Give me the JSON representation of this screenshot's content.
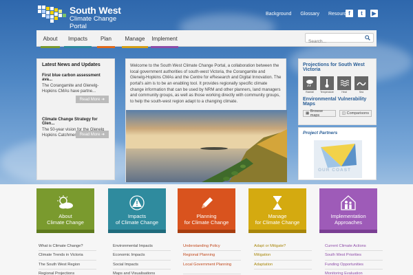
{
  "brand": {
    "line1": "South West",
    "line2": "Climate Change",
    "line3": "Portal"
  },
  "top_links": [
    "Background",
    "Glossary",
    "Resources"
  ],
  "nav": {
    "items": [
      {
        "label": "About",
        "color": "#7a9a2e"
      },
      {
        "label": "Impacts",
        "color": "#2f8b9e"
      },
      {
        "label": "Plan",
        "color": "#e06a1b"
      },
      {
        "label": "Manage",
        "color": "#d4a017"
      },
      {
        "label": "Implement",
        "color": "#8e4ca8"
      }
    ],
    "search_placeholder": "Search..."
  },
  "news": {
    "title": "Latest News and Updates",
    "items": [
      {
        "title": "First blue carbon assessment ava...",
        "summary": "The Corangamite and Glenelg-Hopkins CMAs have partne..."
      },
      {
        "title": "Climate Change Strategy for Glen...",
        "summary": "The 50-year vision for the Glenelg Hopkins Catchment..."
      }
    ],
    "read_more": "Read More"
  },
  "welcome": {
    "text": "Welcome to the South West Climate Change Portal, a collaboration between the local government authorities of south-west Victoria, the Corangamite and Glenelg-Hopkins CMAs and the Centre for eResearch and Digital Innovation. The portal's aim is to be an enabling tool. It provides regionally specific climate change information that can be used by NRM and other planners, land managers and community groups, as well as those working directly with community groups, to help the south-west region adapt to a changing climate."
  },
  "projections": {
    "title": "Projections for South West Victoria",
    "tiles": [
      "Rainfall",
      "Temperature",
      "Heat",
      "Sea"
    ],
    "vuln_title": "Environmental Vulnerability Maps",
    "browse": "Browse maps",
    "compare": "Comparisons"
  },
  "partners": {
    "title": "Project Partners",
    "logo_text": "OUR COAST"
  },
  "cards": [
    {
      "line1": "About",
      "line2": "Climate Change",
      "color": "#7a9a2e",
      "strip": "#5e7a1e",
      "icon": "sun-cloud-icon",
      "links": [
        "What is Climate Change?",
        "Climate Trends in Victoria",
        "The South West Region",
        "Regional Projections"
      ]
    },
    {
      "line1": "Impacts",
      "line2": "of Climate Change",
      "color": "#2f8b9e",
      "strip": "#1f6b7c",
      "icon": "warning-icon",
      "links": [
        "Environmental Impacts",
        "Economic Impacts",
        "Social Impacts",
        "Maps and Visualisations"
      ]
    },
    {
      "line1": "Planning",
      "line2": "for Climate Change",
      "color": "#d9531e",
      "strip": "#a83e10",
      "icon": "pencil-icon",
      "links": [
        "Understanding Policy",
        "Regional Planning",
        "Local Government Planning"
      ]
    },
    {
      "line1": "Manage",
      "line2": "for Climate Change",
      "color": "#d4aa10",
      "strip": "#a8860a",
      "icon": "hourglass-icon",
      "links": [
        "Adapt or Mitigate?",
        "Mitigation",
        "Adaptation"
      ]
    },
    {
      "line1": "Implementation",
      "line2": "Approaches",
      "color": "#9e5bb8",
      "strip": "#7a3e93",
      "icon": "people-house-icon",
      "links": [
        "Current Climate Actions",
        "South West Priorities",
        "Funding Opportunities",
        "Monitoring Evaluation"
      ]
    }
  ]
}
